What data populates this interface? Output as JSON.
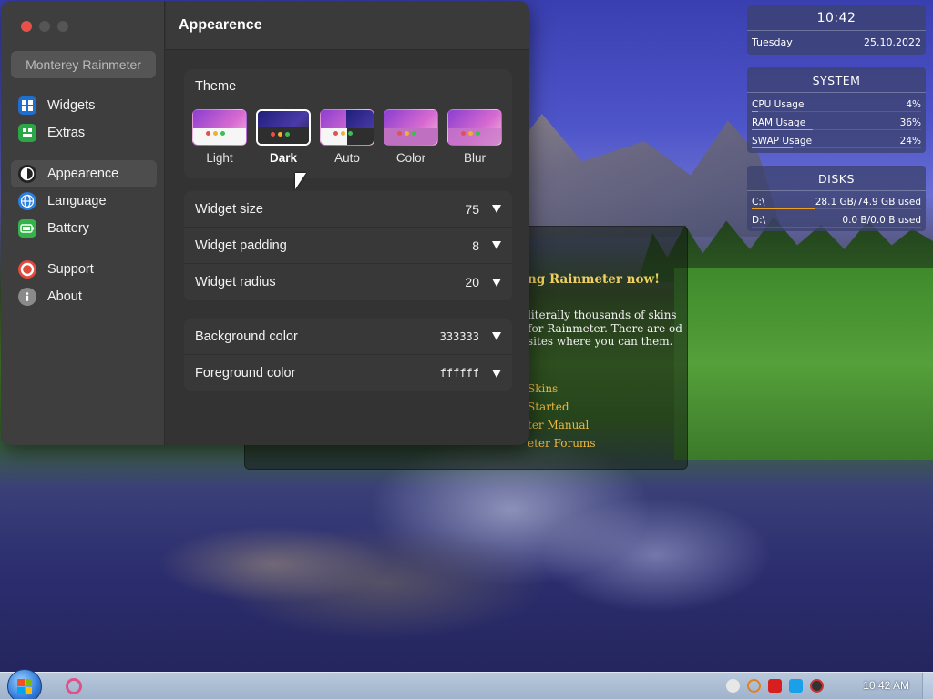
{
  "desktop": {
    "welcome": {
      "title": "ng Rainmeter now!",
      "body": "literally thousands of skins for Rainmeter. There are od sites where you can them.",
      "links": [
        "Skins",
        "Started",
        "ter Manual",
        "eter Forums"
      ]
    },
    "clock": {
      "time": "10:42",
      "day": "Tuesday",
      "date": "25.10.2022"
    },
    "system": {
      "title": "SYSTEM",
      "rows": [
        {
          "label": "CPU Usage",
          "value": "4%",
          "pct": 4
        },
        {
          "label": "RAM Usage",
          "value": "36%",
          "pct": 36
        },
        {
          "label": "SWAP Usage",
          "value": "24%",
          "pct": 24
        }
      ]
    },
    "disks": {
      "title": "DISKS",
      "rows": [
        {
          "label": "C:\\",
          "value": "28.1 GB/74.9 GB used",
          "pct": 37.5
        },
        {
          "label": "D:\\",
          "value": "0.0 B/0.0 B used",
          "pct": 0
        }
      ]
    }
  },
  "window": {
    "app_name": "Monterey Rainmeter",
    "header_title": "Appearence",
    "nav": {
      "widgets": "Widgets",
      "extras": "Extras",
      "appearence": "Appearence",
      "language": "Language",
      "battery": "Battery",
      "support": "Support",
      "about": "About"
    },
    "theme": {
      "title": "Theme",
      "options": [
        "Light",
        "Dark",
        "Auto",
        "Color",
        "Blur"
      ],
      "selected": "Dark"
    },
    "settings": {
      "widget_size": {
        "label": "Widget size",
        "value": "75"
      },
      "widget_padding": {
        "label": "Widget padding",
        "value": "8"
      },
      "widget_radius": {
        "label": "Widget radius",
        "value": "20"
      },
      "background_color": {
        "label": "Background color",
        "value": "333333"
      },
      "foreground_color": {
        "label": "Foreground color",
        "value": "ffffff"
      }
    }
  },
  "taskbar": {
    "time": "10:42 AM"
  },
  "colors": {
    "window_bg": "#333333",
    "sidebar_bg": "#3e3e3e",
    "close_button": "#e8504a",
    "accent_bar": "#f0a020",
    "welcome_title": "#f0d060",
    "welcome_link": "#f0b840"
  },
  "icons": {
    "widgets": "grid-icon",
    "extras": "puzzle-icon",
    "appearence": "contrast-icon",
    "language": "globe-icon",
    "battery": "battery-icon",
    "support": "lifebuoy-icon",
    "about": "info-icon"
  }
}
